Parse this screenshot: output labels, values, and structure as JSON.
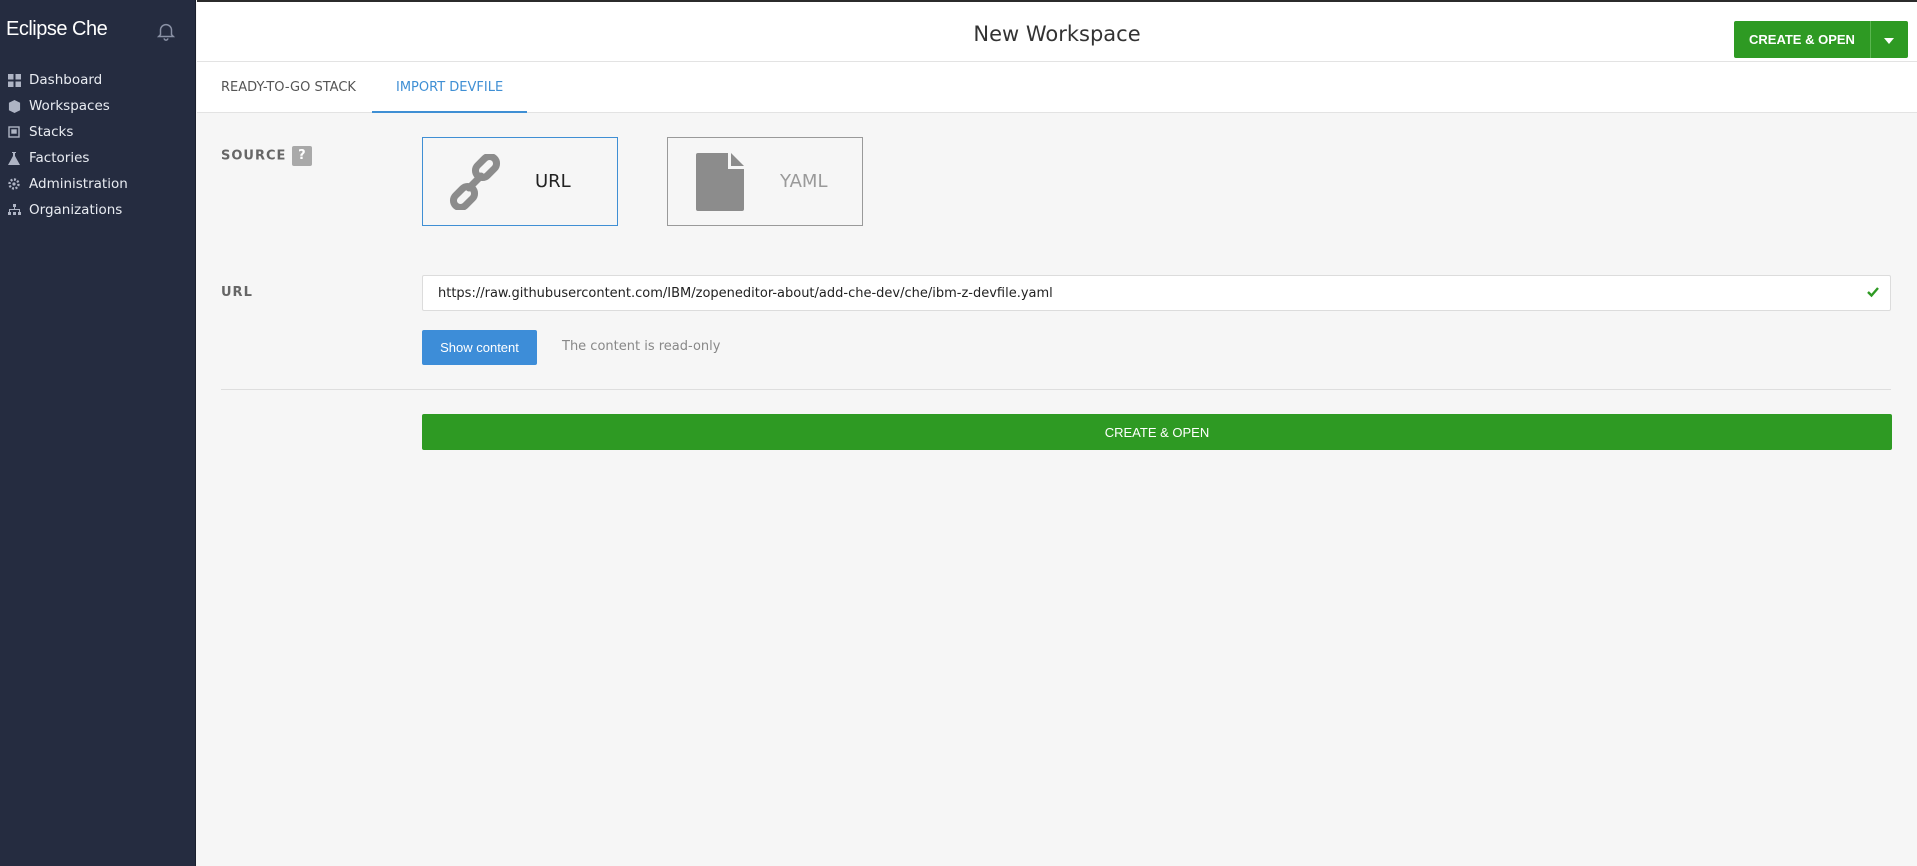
{
  "app": {
    "brand": "Eclipse Che"
  },
  "sidebar": {
    "items": [
      {
        "label": "Dashboard",
        "icon": "dashboard-grid-icon"
      },
      {
        "label": "Workspaces",
        "icon": "workspaces-cube-icon"
      },
      {
        "label": "Stacks",
        "icon": "stacks-box-icon"
      },
      {
        "label": "Factories",
        "icon": "factories-flask-icon"
      },
      {
        "label": "Administration",
        "icon": "administration-gear-icon"
      },
      {
        "label": "Organizations",
        "icon": "organizations-sitemap-icon"
      }
    ]
  },
  "header": {
    "title": "New Workspace",
    "create_label": "CREATE & OPEN"
  },
  "tabs": [
    {
      "label": "READY-TO-GO STACK",
      "active": false
    },
    {
      "label": "IMPORT DEVFILE",
      "active": true
    }
  ],
  "source": {
    "label": "SOURCE",
    "help": "?",
    "options": [
      {
        "label": "URL",
        "selected": true,
        "icon": "link-chain-icon"
      },
      {
        "label": "YAML",
        "selected": false,
        "icon": "file-icon"
      }
    ]
  },
  "url_field": {
    "label": "URL",
    "value": "https://raw.githubusercontent.com/IBM/zopeneditor-about/add-che-dev/che/ibm-z-devfile.yaml"
  },
  "show_content": {
    "button_label": "Show content",
    "note": "The content is read-only"
  },
  "footer": {
    "create_label": "CREATE & OPEN"
  },
  "colors": {
    "sidebar_bg": "#252c40",
    "primary_green": "#2e9a23",
    "accent_blue": "#3f8fd4",
    "button_blue": "#3d8dd8"
  }
}
